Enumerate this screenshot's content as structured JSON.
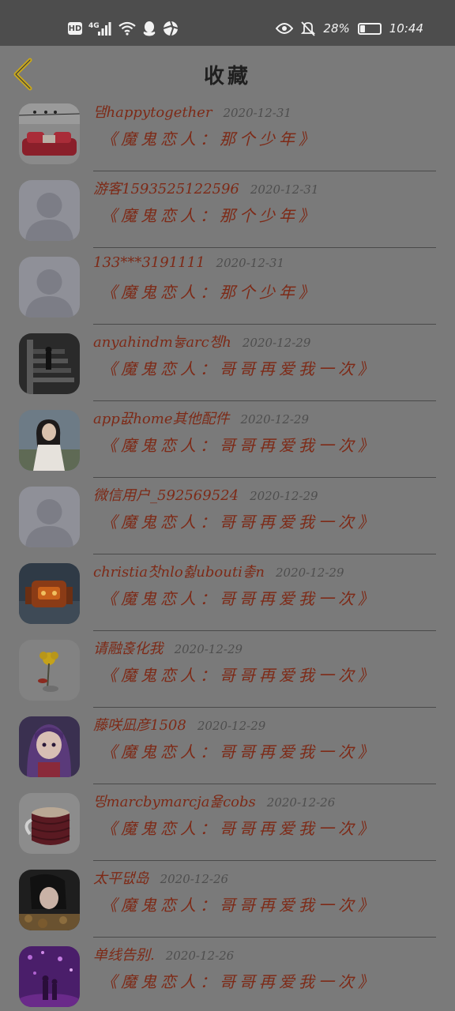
{
  "status_bar": {
    "hd_label": "HD",
    "network_label": "4G",
    "battery_percent_label": "28%",
    "battery_level": 0.28,
    "time": "10:44",
    "icons": [
      "hd-icon",
      "signal-icon",
      "wifi-icon",
      "qq-icon",
      "app-icon",
      "eye-icon",
      "bell-off-icon",
      "battery-icon"
    ]
  },
  "header": {
    "title": "收藏",
    "back_icon": "chevron-left-icon"
  },
  "colors": {
    "accent": "#7d2a17",
    "back_icon": "#c9a81a",
    "overlay": "#7a7a7a"
  },
  "favorites": [
    {
      "username": "댐happytogether",
      "date": "2020-12-31",
      "work": "《魔鬼恋人：那个少年》",
      "avatar": "red-sofa-photo"
    },
    {
      "username": "游客1593525122596",
      "date": "2020-12-31",
      "work": "《魔鬼恋人：那个少年》",
      "avatar": "default-avatar"
    },
    {
      "username": "133***3191111",
      "date": "2020-12-31",
      "work": "《魔鬼恋人：那个少年》",
      "avatar": "default-avatar"
    },
    {
      "username": "anyahindm늏arc쳉h",
      "date": "2020-12-29",
      "work": "《魔鬼恋人：哥哥再爱我一次》",
      "avatar": "stairs-photo"
    },
    {
      "username": "app끖home其他配件",
      "date": "2020-12-29",
      "work": "《魔鬼恋人：哥哥再爱我一次》",
      "avatar": "girl-white-dress-photo"
    },
    {
      "username": "微信用户_592569524",
      "date": "2020-12-29",
      "work": "《魔鬼恋人：哥哥再爱我一次》",
      "avatar": "default-avatar"
    },
    {
      "username": "christia찻nlo췷ubouti촣n",
      "date": "2020-12-29",
      "work": "《魔鬼恋人：哥哥再爱我一次》",
      "avatar": "robot-photo"
    },
    {
      "username": "请融혽化我",
      "date": "2020-12-29",
      "work": "《魔鬼恋人：哥哥再爱我一次》",
      "avatar": "yellow-flower-photo"
    },
    {
      "username": "藤咲凪彦1508",
      "date": "2020-12-29",
      "work": "《魔鬼恋人：哥哥再爱我一次》",
      "avatar": "anime-girl-photo"
    },
    {
      "username": "띵marcbymarcja욡cobs",
      "date": "2020-12-26",
      "work": "《魔鬼恋人：哥哥再爱我一次》",
      "avatar": "coffee-mug-photo"
    },
    {
      "username": "太平댒岛",
      "date": "2020-12-26",
      "work": "《魔鬼恋人：哥哥再爱我一次》",
      "avatar": "woman-leaves-photo"
    },
    {
      "username": "单线告别.",
      "date": "2020-12-26",
      "work": "《魔鬼恋人：哥哥再爱我一次》",
      "avatar": "purple-lights-photo"
    }
  ]
}
